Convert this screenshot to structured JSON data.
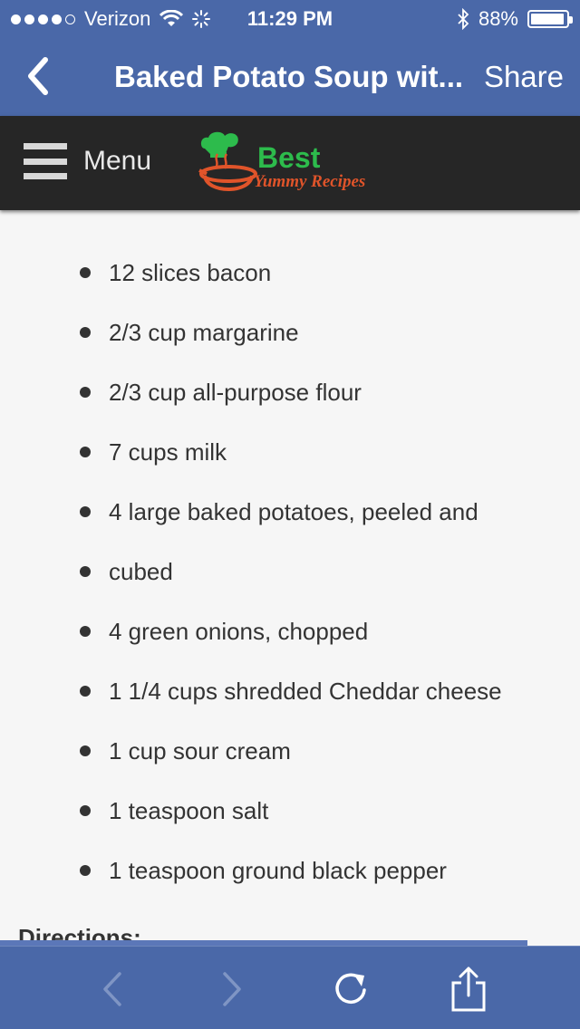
{
  "status_bar": {
    "carrier": "Verizon",
    "time": "11:29 PM",
    "battery": "88%",
    "battery_level": 0.88,
    "signal_bars_filled": 4,
    "signal_bars_total": 5
  },
  "nav_bar": {
    "title": "Baked Potato Soup wit...",
    "share_label": "Share"
  },
  "site_header": {
    "menu_label": "Menu",
    "logo_line1": "Best",
    "logo_line2": "Yummy Recipes"
  },
  "ingredients": [
    "12 slices bacon",
    "2/3 cup margarine",
    "2/3 cup all-purpose flour",
    "7 cups milk",
    "4 large baked potatoes, peeled and",
    "cubed",
    "4 green onions, chopped",
    "1 1/4 cups shredded Cheddar cheese",
    "1 cup sour cream",
    "1 teaspoon salt",
    "1 teaspoon ground black pepper"
  ],
  "directions_heading": "Directions:",
  "colors": {
    "nav_blue": "#4a68a8",
    "header_dark": "#262626",
    "logo_green": "#2dbb4c",
    "logo_orange": "#e0542a"
  },
  "page_load_progress": 0.91,
  "toolbar_icons": [
    "back-arrow-icon",
    "forward-arrow-icon",
    "reload-icon",
    "share-icon"
  ]
}
